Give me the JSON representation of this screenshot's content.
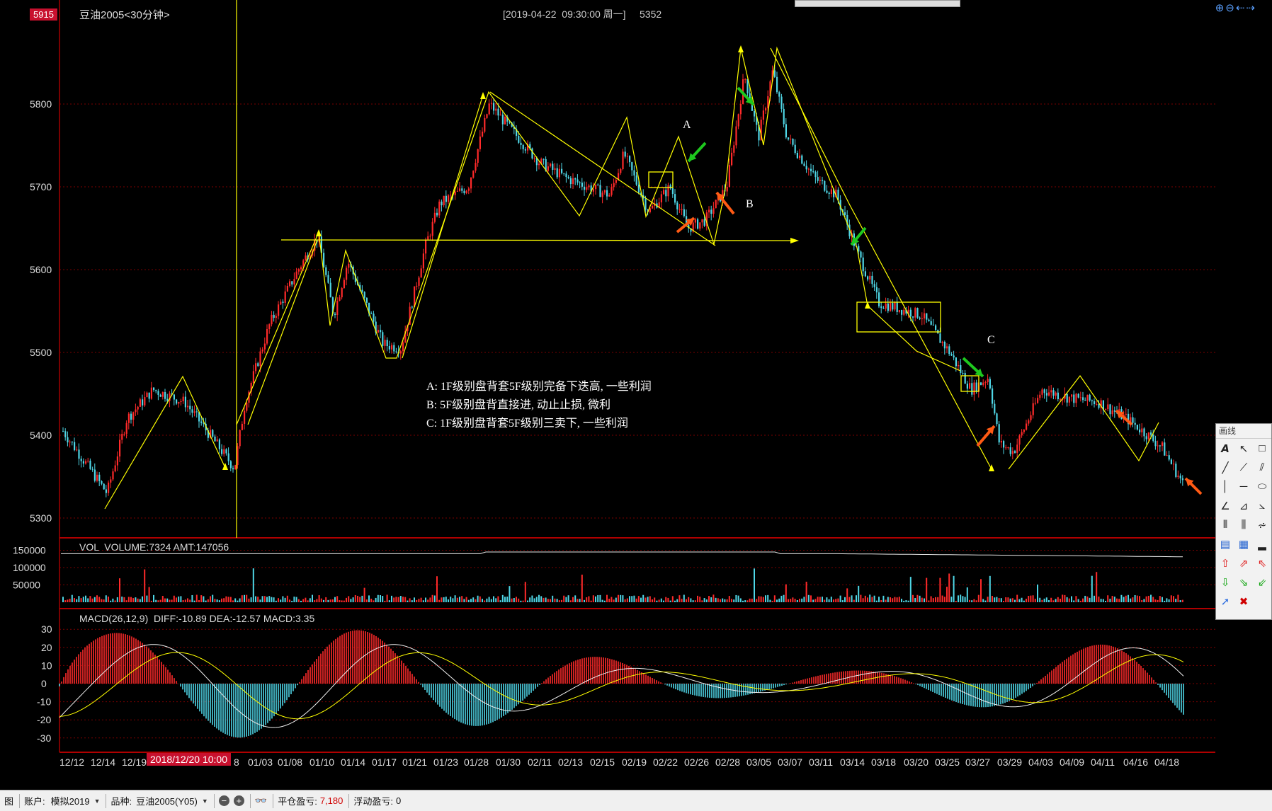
{
  "header": {
    "price_badge": "5915",
    "instrument_title": "豆油2005<30分钟>",
    "datetime_info": "[2019-04-22  09:30:00 周一]     5352"
  },
  "colors": {
    "background": "#000000",
    "up_candle": "#ff2a2a",
    "down_candle": "#4fd6e6",
    "trend_line": "#ffff00",
    "grid": "#7a0000",
    "arrow_green": "#1ec81e",
    "arrow_orange": "#ff5a14"
  },
  "annotations": {
    "line_a": "A: 1F级别盘背套5F级别完备下迭高, 一些利润",
    "line_b": "B: 5F级别盘背直接进, 动止止损, 微利",
    "line_c": "C: 1F级别盘背套5F级别三卖下, 一些利润",
    "point_a": "A",
    "point_b": "B",
    "point_c": "C"
  },
  "price_axis": {
    "ticks": [
      "5800",
      "5700",
      "5600",
      "5500",
      "5400",
      "5300"
    ]
  },
  "volume_panel": {
    "label": "VOL  VOLUME:7324 AMT:147056",
    "ticks": [
      "150000",
      "100000",
      "50000"
    ]
  },
  "macd_panel": {
    "label": "MACD(26,12,9)  DIFF:-10.89 DEA:-12.57 MACD:3.35",
    "ticks": [
      "30",
      "20",
      "10",
      "0",
      "-10",
      "-20",
      "-30"
    ]
  },
  "date_axis": {
    "labels": [
      "12/12",
      "12/14",
      "12/19",
      "8",
      "01/03",
      "01/08",
      "01/10",
      "01/14",
      "01/17",
      "01/21",
      "01/23",
      "01/28",
      "01/30",
      "02/11",
      "02/13",
      "02/15",
      "02/19",
      "02/22",
      "02/26",
      "02/28",
      "03/05",
      "03/07",
      "03/11",
      "03/14",
      "03/18",
      "03/20",
      "03/25",
      "03/27",
      "03/29",
      "04/03",
      "04/09",
      "04/11",
      "04/16",
      "04/18"
    ],
    "highlight": "2018/12/20 10:00"
  },
  "palette": {
    "title": "画线",
    "tools": [
      "text-tool",
      "pointer-tool",
      "rectangle-tool",
      "line-tool",
      "ray-tool",
      "parallel-line-tool",
      "vertical-line-tool",
      "horizontal-line-tool",
      "ellipse-tool",
      "angle-tool",
      "fan-tool",
      "gann-tool",
      "period-lines-tool",
      "triple-lines-tool",
      "fibonacci-tool",
      "flag-cn-tool",
      "flag-grid-tool",
      "bar-tool",
      "arrow-up-red-tool",
      "arrow-upright-red-tool",
      "arrow-upleft-red-tool",
      "arrow-down-green-tool",
      "arrow-downright-green-tool",
      "arrow-downleft-green-tool",
      "cursor-tool",
      "delete-tool"
    ]
  },
  "statusbar": {
    "view_label": "图",
    "account_label": "账户:",
    "account_value": "模拟2019",
    "instrument_label": "品种:",
    "instrument_value": "豆油2005(Y05)",
    "close_profit_label": "平仓盈亏:",
    "close_profit_value": "7,180",
    "float_profit_label": "浮动盈亏:",
    "float_profit_value": "0"
  }
}
